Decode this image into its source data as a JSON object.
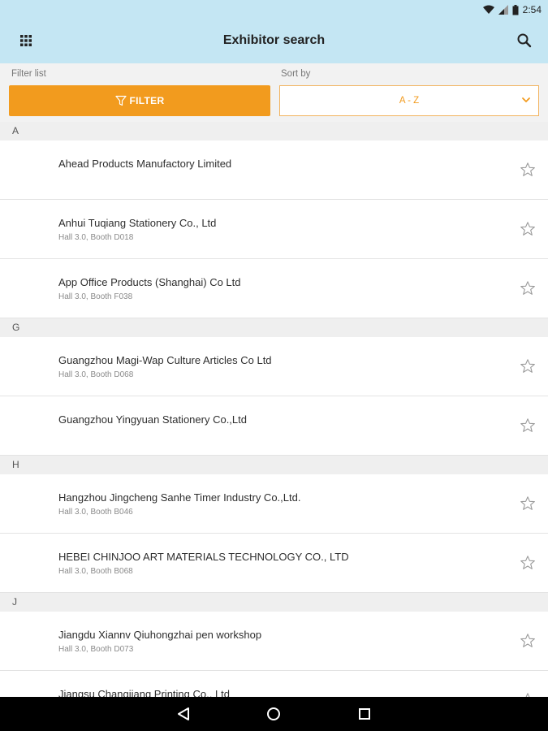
{
  "status_bar": {
    "time": "2:54",
    "icons": [
      "wifi-icon",
      "signal-icon",
      "battery-icon"
    ]
  },
  "app_bar": {
    "title": "Exhibitor search",
    "left_icon": "grid-icon",
    "right_icon": "search-icon",
    "background": "#c4e6f3"
  },
  "filter": {
    "filter_label": "Filter list",
    "sort_label": "Sort by",
    "filter_button": "FILTER",
    "sort_value": "A - Z",
    "accent": "#f29b1e"
  },
  "sections": [
    {
      "letter": "A",
      "items": [
        {
          "name": "Ahead Products Manufactory Limited",
          "booth": ""
        },
        {
          "name": "Anhui Tuqiang Stationery Co., Ltd",
          "booth": "Hall 3.0, Booth D018"
        },
        {
          "name": "App Office Products (Shanghai) Co Ltd",
          "booth": "Hall 3.0, Booth F038"
        }
      ]
    },
    {
      "letter": "G",
      "items": [
        {
          "name": "Guangzhou Magi-Wap Culture Articles Co Ltd",
          "booth": "Hall 3.0, Booth D068"
        },
        {
          "name": "Guangzhou Yingyuan Stationery Co.,Ltd",
          "booth": ""
        }
      ]
    },
    {
      "letter": "H",
      "items": [
        {
          "name": "Hangzhou Jingcheng Sanhe Timer Industry Co.,Ltd.",
          "booth": "Hall 3.0, Booth B046"
        },
        {
          "name": "HEBEI CHINJOO ART MATERIALS TECHNOLOGY CO., LTD",
          "booth": "Hall 3.0, Booth B068"
        }
      ]
    },
    {
      "letter": "J",
      "items": [
        {
          "name": "Jiangdu Xiannv Qiuhongzhai pen workshop",
          "booth": "Hall 3.0, Booth D073"
        },
        {
          "name": "Jiangsu Changjiang Printing Co., Ltd",
          "booth": ""
        }
      ]
    }
  ],
  "nav_bar": {
    "icons": [
      "back-icon",
      "home-icon",
      "recents-icon"
    ]
  }
}
